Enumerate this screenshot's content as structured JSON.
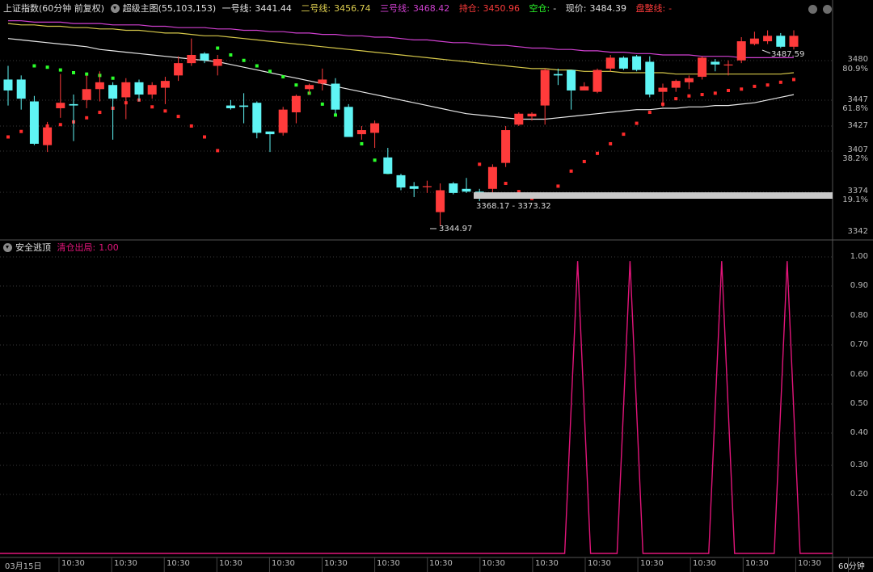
{
  "top_panel": {
    "index_name": "上证指数(60分钟 前复权)",
    "indicator_name": "超级主图(55,103,153)",
    "line1_label": "一号线:",
    "line1_value": "3441.44",
    "line2_label": "二号线:",
    "line2_value": "3456.74",
    "line3_label": "三号线:",
    "line3_value": "3468.42",
    "hold_label": "持仓:",
    "hold_value": "3450.96",
    "empty_label": "空仓:",
    "empty_value": "-",
    "price_label": "现价:",
    "price_value": "3484.39",
    "consolidation_label": "盘整线:",
    "consolidation_value": "-",
    "high_annotation": "3487.59",
    "low_annotation": "3344.97",
    "range_annotation": "3368.17 - 3373.32"
  },
  "bottom_panel": {
    "indicator_name": "安全逃顶",
    "signal_label": "清仓出局:",
    "signal_value": "1.00"
  },
  "price_axis": {
    "ticks": [
      "3480",
      "3447",
      "3427",
      "3407",
      "3374",
      "3342"
    ],
    "pct_ticks": [
      "80.9%",
      "61.8%",
      "38.2%",
      "19.1%"
    ]
  },
  "signal_axis": {
    "ticks": [
      "1.00",
      "0.90",
      "0.80",
      "0.70",
      "0.60",
      "0.50",
      "0.40",
      "0.30",
      "0.20"
    ]
  },
  "x_axis": {
    "labels": [
      "03月15日",
      "10:30",
      "10:30",
      "10:30",
      "10:30",
      "10:30",
      "10:30",
      "10:30",
      "10:30",
      "10:30",
      "10:30",
      "10:30",
      "10:30",
      "10:30",
      "10:30",
      "10:30"
    ],
    "period_label": "60分钟"
  },
  "colors": {
    "up": "#ff3b3b",
    "down": "#5ff4f4",
    "line1": "#e8e8e8",
    "line2": "#d6c84a",
    "line3": "#d040d0",
    "dots_green": "#2bff2b",
    "dots_red": "#ff2b2b",
    "signal": "#e2157a"
  },
  "chart_data": [
    {
      "type": "candlestick",
      "title": "上证指数(60分钟 前复权)",
      "y_range": [
        3337,
        3496
      ],
      "candles": [
        {
          "o": 3452,
          "c": 3444,
          "h": 3462,
          "l": 3433
        },
        {
          "o": 3452,
          "c": 3438,
          "h": 3455,
          "l": 3430
        },
        {
          "o": 3436,
          "c": 3405,
          "h": 3440,
          "l": 3404
        },
        {
          "o": 3404,
          "c": 3417,
          "h": 3421,
          "l": 3399
        },
        {
          "o": 3431,
          "c": 3435,
          "h": 3456,
          "l": 3424
        },
        {
          "o": 3434,
          "c": 3433,
          "h": 3441,
          "l": 3407
        },
        {
          "o": 3437,
          "c": 3445,
          "h": 3455,
          "l": 3431
        },
        {
          "o": 3445,
          "c": 3450,
          "h": 3458,
          "l": 3436
        },
        {
          "o": 3448,
          "c": 3438,
          "h": 3450,
          "l": 3408
        },
        {
          "o": 3439,
          "c": 3450,
          "h": 3453,
          "l": 3423
        },
        {
          "o": 3450,
          "c": 3441,
          "h": 3452,
          "l": 3436
        },
        {
          "o": 3441,
          "c": 3448,
          "h": 3450,
          "l": 3438
        },
        {
          "o": 3446,
          "c": 3451,
          "h": 3454,
          "l": 3434
        },
        {
          "o": 3455,
          "c": 3464,
          "h": 3469,
          "l": 3451
        },
        {
          "o": 3464,
          "c": 3470,
          "h": 3482,
          "l": 3462
        },
        {
          "o": 3471,
          "c": 3466,
          "h": 3472,
          "l": 3464
        },
        {
          "o": 3462,
          "c": 3467,
          "h": 3470,
          "l": 3455
        },
        {
          "o": 3433,
          "c": 3431,
          "h": 3437,
          "l": 3430
        },
        {
          "o": 3433,
          "c": 3432,
          "h": 3442,
          "l": 3420
        },
        {
          "o": 3435,
          "c": 3413,
          "h": 3436,
          "l": 3409
        },
        {
          "o": 3414,
          "c": 3412,
          "h": 3414,
          "l": 3399
        },
        {
          "o": 3413,
          "c": 3430,
          "h": 3432,
          "l": 3411
        },
        {
          "o": 3428,
          "c": 3440,
          "h": 3441,
          "l": 3420
        },
        {
          "o": 3445,
          "c": 3448,
          "h": 3449,
          "l": 3441
        },
        {
          "o": 3449,
          "c": 3452,
          "h": 3460,
          "l": 3444
        },
        {
          "o": 3449,
          "c": 3430,
          "h": 3453,
          "l": 3427
        },
        {
          "o": 3432,
          "c": 3410,
          "h": 3434,
          "l": 3410
        },
        {
          "o": 3412,
          "c": 3415,
          "h": 3418,
          "l": 3408
        },
        {
          "o": 3413,
          "c": 3420,
          "h": 3422,
          "l": 3402
        },
        {
          "o": 3395,
          "c": 3383,
          "h": 3402,
          "l": 3383
        },
        {
          "o": 3382,
          "c": 3373,
          "h": 3383,
          "l": 3371
        },
        {
          "o": 3374,
          "c": 3372,
          "h": 3377,
          "l": 3366
        },
        {
          "o": 3374,
          "c": 3374,
          "h": 3378,
          "l": 3369
        },
        {
          "o": 3355,
          "c": 3371,
          "h": 3376,
          "l": 3345
        },
        {
          "o": 3376,
          "c": 3369,
          "h": 3377,
          "l": 3368
        },
        {
          "o": 3372,
          "c": 3370,
          "h": 3380,
          "l": 3369
        },
        {
          "o": 3370,
          "c": 3368,
          "h": 3372,
          "l": 3363
        },
        {
          "o": 3372,
          "c": 3388,
          "h": 3390,
          "l": 3368
        },
        {
          "o": 3391,
          "c": 3415,
          "h": 3418,
          "l": 3388
        },
        {
          "o": 3419,
          "c": 3427,
          "h": 3428,
          "l": 3418
        },
        {
          "o": 3425,
          "c": 3427,
          "h": 3428,
          "l": 3422
        },
        {
          "o": 3433,
          "c": 3459,
          "h": 3460,
          "l": 3419
        },
        {
          "o": 3456,
          "c": 3455,
          "h": 3460,
          "l": 3448
        },
        {
          "o": 3459,
          "c": 3444,
          "h": 3459,
          "l": 3430
        },
        {
          "o": 3444,
          "c": 3447,
          "h": 3450,
          "l": 3444
        },
        {
          "o": 3443,
          "c": 3459,
          "h": 3460,
          "l": 3442
        },
        {
          "o": 3460,
          "c": 3468,
          "h": 3470,
          "l": 3458
        },
        {
          "o": 3468,
          "c": 3460,
          "h": 3469,
          "l": 3459
        },
        {
          "o": 3469,
          "c": 3459,
          "h": 3470,
          "l": 3458
        },
        {
          "o": 3465,
          "c": 3441,
          "h": 3469,
          "l": 3439
        },
        {
          "o": 3443,
          "c": 3446,
          "h": 3449,
          "l": 3432
        },
        {
          "o": 3446,
          "c": 3451,
          "h": 3452,
          "l": 3443
        },
        {
          "o": 3450,
          "c": 3453,
          "h": 3455,
          "l": 3445
        },
        {
          "o": 3454,
          "c": 3468,
          "h": 3469,
          "l": 3452
        },
        {
          "o": 3465,
          "c": 3463,
          "h": 3467,
          "l": 3458
        },
        {
          "o": 3463,
          "c": 3463,
          "h": 3466,
          "l": 3455
        },
        {
          "o": 3466,
          "c": 3480,
          "h": 3483,
          "l": 3464
        },
        {
          "o": 3478,
          "c": 3482,
          "h": 3487,
          "l": 3477
        },
        {
          "o": 3480,
          "c": 3484,
          "h": 3488,
          "l": 3478
        },
        {
          "o": 3484,
          "c": 3476,
          "h": 3486,
          "l": 3475
        },
        {
          "o": 3476,
          "c": 3484,
          "h": 3488,
          "l": 3474
        }
      ],
      "series": [
        {
          "name": "一号线",
          "values": [
            3482,
            3481,
            3480,
            3479,
            3478,
            3477,
            3476,
            3474,
            3473,
            3472,
            3471,
            3470,
            3469,
            3468,
            3467,
            3466,
            3465,
            3463,
            3461,
            3459,
            3457,
            3455,
            3453,
            3451,
            3449,
            3447,
            3445,
            3443,
            3441,
            3439,
            3437,
            3435,
            3433,
            3431,
            3429,
            3427,
            3426,
            3425,
            3424,
            3423,
            3423,
            3423,
            3424,
            3425,
            3426,
            3427,
            3428,
            3429,
            3430,
            3430,
            3431,
            3431,
            3432,
            3432,
            3433,
            3433,
            3434,
            3435,
            3437,
            3439,
            3441
          ]
        },
        {
          "name": "二号线",
          "values": [
            3493,
            3492,
            3492,
            3491,
            3491,
            3490,
            3490,
            3489,
            3489,
            3488,
            3488,
            3487,
            3486,
            3486,
            3485,
            3484,
            3484,
            3483,
            3482,
            3481,
            3480,
            3479,
            3478,
            3477,
            3476,
            3475,
            3474,
            3473,
            3472,
            3471,
            3470,
            3469,
            3468,
            3467,
            3466,
            3465,
            3464,
            3463,
            3462,
            3461,
            3460,
            3460,
            3459,
            3459,
            3458,
            3458,
            3458,
            3457,
            3457,
            3457,
            3457,
            3456,
            3456,
            3456,
            3456,
            3456,
            3456,
            3456,
            3456,
            3456,
            3457
          ]
        },
        {
          "name": "三号线",
          "values": [
            3495,
            3495,
            3494,
            3494,
            3494,
            3493,
            3493,
            3493,
            3492,
            3492,
            3492,
            3491,
            3491,
            3490,
            3490,
            3490,
            3489,
            3489,
            3488,
            3488,
            3487,
            3487,
            3486,
            3486,
            3485,
            3485,
            3484,
            3484,
            3483,
            3483,
            3482,
            3481,
            3481,
            3480,
            3479,
            3479,
            3478,
            3477,
            3477,
            3476,
            3475,
            3475,
            3474,
            3474,
            3473,
            3473,
            3472,
            3472,
            3471,
            3471,
            3470,
            3470,
            3470,
            3469,
            3469,
            3469,
            3468,
            3468,
            3468,
            3468,
            3468
          ]
        }
      ],
      "markers_green": [
        3462,
        3461,
        3459,
        3457,
        3456,
        3455,
        3453,
        3475,
        3470,
        3466,
        3462,
        3458,
        3454,
        3448,
        3442,
        3434,
        3426,
        3416,
        3405,
        3393,
        3384,
        3378
      ],
      "markers_red": [
        3410,
        3414,
        3416,
        3418,
        3419,
        3421,
        3424,
        3428,
        3431,
        3435,
        3437,
        3432,
        3429,
        3425,
        3418,
        3410,
        3400,
        3390,
        3383,
        3376,
        3370,
        3365,
        3366,
        3374,
        3385,
        3392,
        3398,
        3405,
        3412,
        3420,
        3428,
        3434,
        3438,
        3440,
        3441,
        3442,
        3444,
        3445,
        3447,
        3448,
        3450,
        3452,
        3454,
        3459
      ]
    },
    {
      "type": "line",
      "title": "安全逃顶",
      "y_range": [
        0,
        1.05
      ],
      "series": [
        {
          "name": "清仓出局",
          "spikes_at_bar": [
            43,
            47,
            54,
            59
          ],
          "value": 1.0
        }
      ]
    }
  ]
}
